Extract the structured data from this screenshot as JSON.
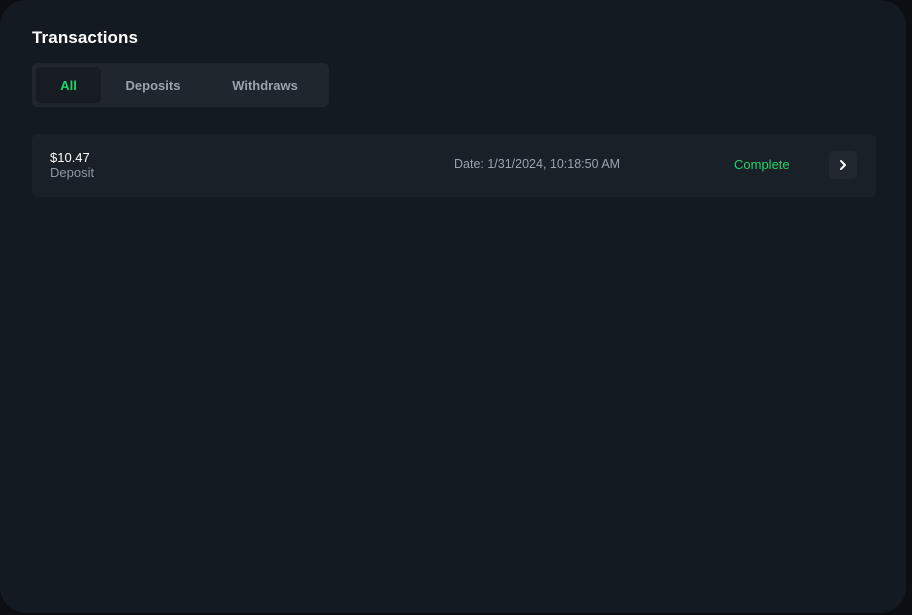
{
  "page": {
    "title": "Transactions"
  },
  "tabs": [
    {
      "label": "All",
      "active": true
    },
    {
      "label": "Deposits",
      "active": false
    },
    {
      "label": "Withdraws",
      "active": false
    }
  ],
  "transactions": [
    {
      "amount": "$10.47",
      "type": "Deposit",
      "date": "Date: 1/31/2024, 10:18:50 AM",
      "status": "Complete",
      "action_icon": "chevron-right-icon"
    }
  ],
  "colors": {
    "accent": "#22d46b",
    "panel": "#141a21",
    "row": "#1a2027"
  }
}
